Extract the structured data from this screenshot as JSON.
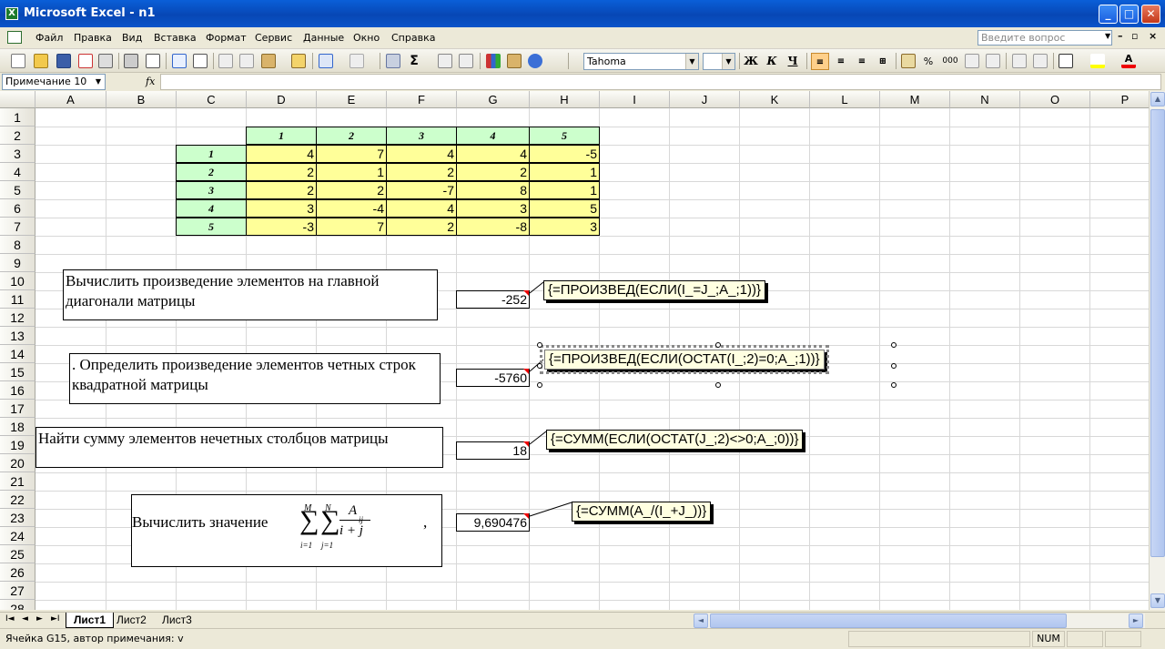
{
  "window": {
    "title": "Microsoft Excel - n1",
    "app_icon": "X",
    "minimize": "_",
    "maximize": "□",
    "close": "✕"
  },
  "menu": {
    "items": [
      "Файл",
      "Правка",
      "Вид",
      "Вставка",
      "Формат",
      "Сервис",
      "Данные",
      "Окно",
      "Справка"
    ],
    "help_placeholder": "Введите вопрос"
  },
  "toolbar": {
    "font_name": "Tahoma",
    "font_size": "",
    "bold": "Ж",
    "italic": "К",
    "underline": "Ч",
    "percent": "%",
    "thousands": "000"
  },
  "formula_bar": {
    "name_box": "Примечание 10",
    "fx": "fx",
    "formula": ""
  },
  "columns": [
    "A",
    "B",
    "C",
    "D",
    "E",
    "F",
    "G",
    "H",
    "I",
    "J",
    "K",
    "L",
    "M",
    "N",
    "O",
    "P"
  ],
  "rows": [
    "1",
    "2",
    "3",
    "4",
    "5",
    "6",
    "7",
    "8",
    "9",
    "10",
    "11",
    "12",
    "13",
    "14",
    "15",
    "16",
    "17",
    "18",
    "19",
    "20",
    "21",
    "22",
    "23",
    "24",
    "25",
    "26",
    "27",
    "28"
  ],
  "matrix": {
    "col_headers": [
      "1",
      "2",
      "3",
      "4",
      "5"
    ],
    "row_headers": [
      "1",
      "2",
      "3",
      "4",
      "5"
    ],
    "values": [
      [
        "4",
        "7",
        "4",
        "4",
        "-5"
      ],
      [
        "2",
        "1",
        "2",
        "2",
        "1"
      ],
      [
        "2",
        "2",
        "-7",
        "8",
        "1"
      ],
      [
        "3",
        "-4",
        "4",
        "3",
        "5"
      ],
      [
        "-3",
        "7",
        "2",
        "-8",
        "3"
      ]
    ]
  },
  "tasks": [
    {
      "text": "Вычислить произведение элементов на главной диагонали  матрицы",
      "result": "-252",
      "formula": "{=ПРОИЗВЕД(ЕСЛИ(I_=J_;A_;1))}"
    },
    {
      "text": ". Определить произведение элементов четных строк квадратной матрицы",
      "result": "-5760",
      "formula": "{=ПРОИЗВЕД(ЕСЛИ(ОСТАТ(I_;2)=0;A_;1))}"
    },
    {
      "text": "Найти сумму элементов нечетных столбцов матрицы",
      "result": "18",
      "formula": "{=СУММ(ЕСЛИ(ОСТАТ(J_;2)<>0;A_;0))}"
    },
    {
      "text": "Вычислить значение",
      "result": "9,690476",
      "formula": "{=СУММ(A_/(I_+J_))}"
    }
  ],
  "math": {
    "upper1": "M",
    "upper2": "N",
    "lower1": "i=1",
    "lower2": "j=1",
    "sigma": "∑",
    "numerator": "A",
    "num_sub": "ij",
    "denominator": "i + j",
    "trail": ","
  },
  "sheets": [
    "Лист1",
    "Лист2",
    "Лист3"
  ],
  "status": {
    "text": "Ячейка G15, автор примечания: v",
    "num": "NUM"
  }
}
